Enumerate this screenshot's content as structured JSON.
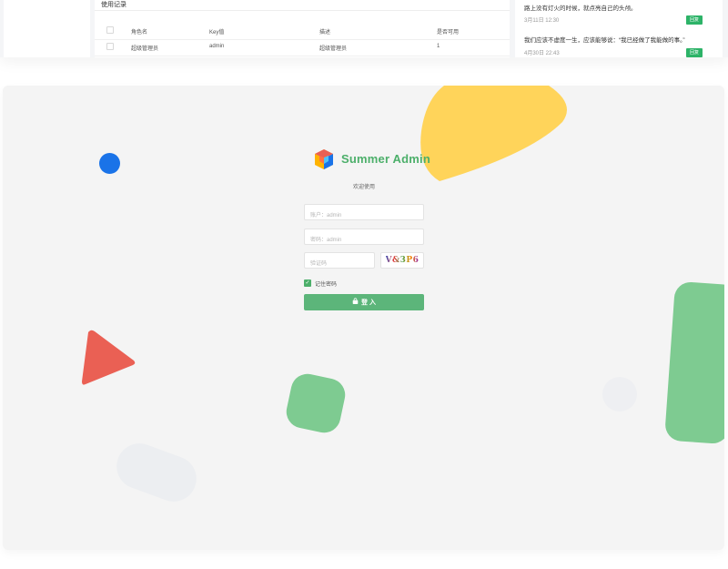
{
  "usage": {
    "title": "使用记录",
    "headers": [
      "角色名",
      "Key值",
      "描述",
      "是否可用"
    ],
    "rows": [
      {
        "name": "超级管理员",
        "key": "admin",
        "desc": "超级管理员",
        "enabled": "1"
      }
    ]
  },
  "messages": [
    {
      "text": "路上没有灯火的时候，就点亮自己的头颅。",
      "time": "3月11日 12:30",
      "reply": "回复"
    },
    {
      "text": "我们应该不虚度一生，应该能够说：“我已经做了我能做的事。”",
      "time": "4月30日 22:43",
      "reply": "回复"
    }
  ],
  "login": {
    "brand": "Summer Admin",
    "welcome": "欢迎使用",
    "account_placeholder": "账户：admin",
    "password_placeholder": "密码：admin",
    "captcha_placeholder": "验证码",
    "captcha_text": "V&3P6",
    "remember_label": "记住密码",
    "remember_checked": true,
    "submit_label": "登 入"
  },
  "colors": {
    "accent_green": "#5cb57a",
    "brand_green": "#4caf6a",
    "yellow": "#ffd45a",
    "blue": "#1a73e8",
    "red": "#ea6054",
    "light_green": "#7ecb91"
  },
  "icons": {
    "logo": "cube-logo-icon",
    "check": "check-icon",
    "lock": "lock-icon"
  }
}
